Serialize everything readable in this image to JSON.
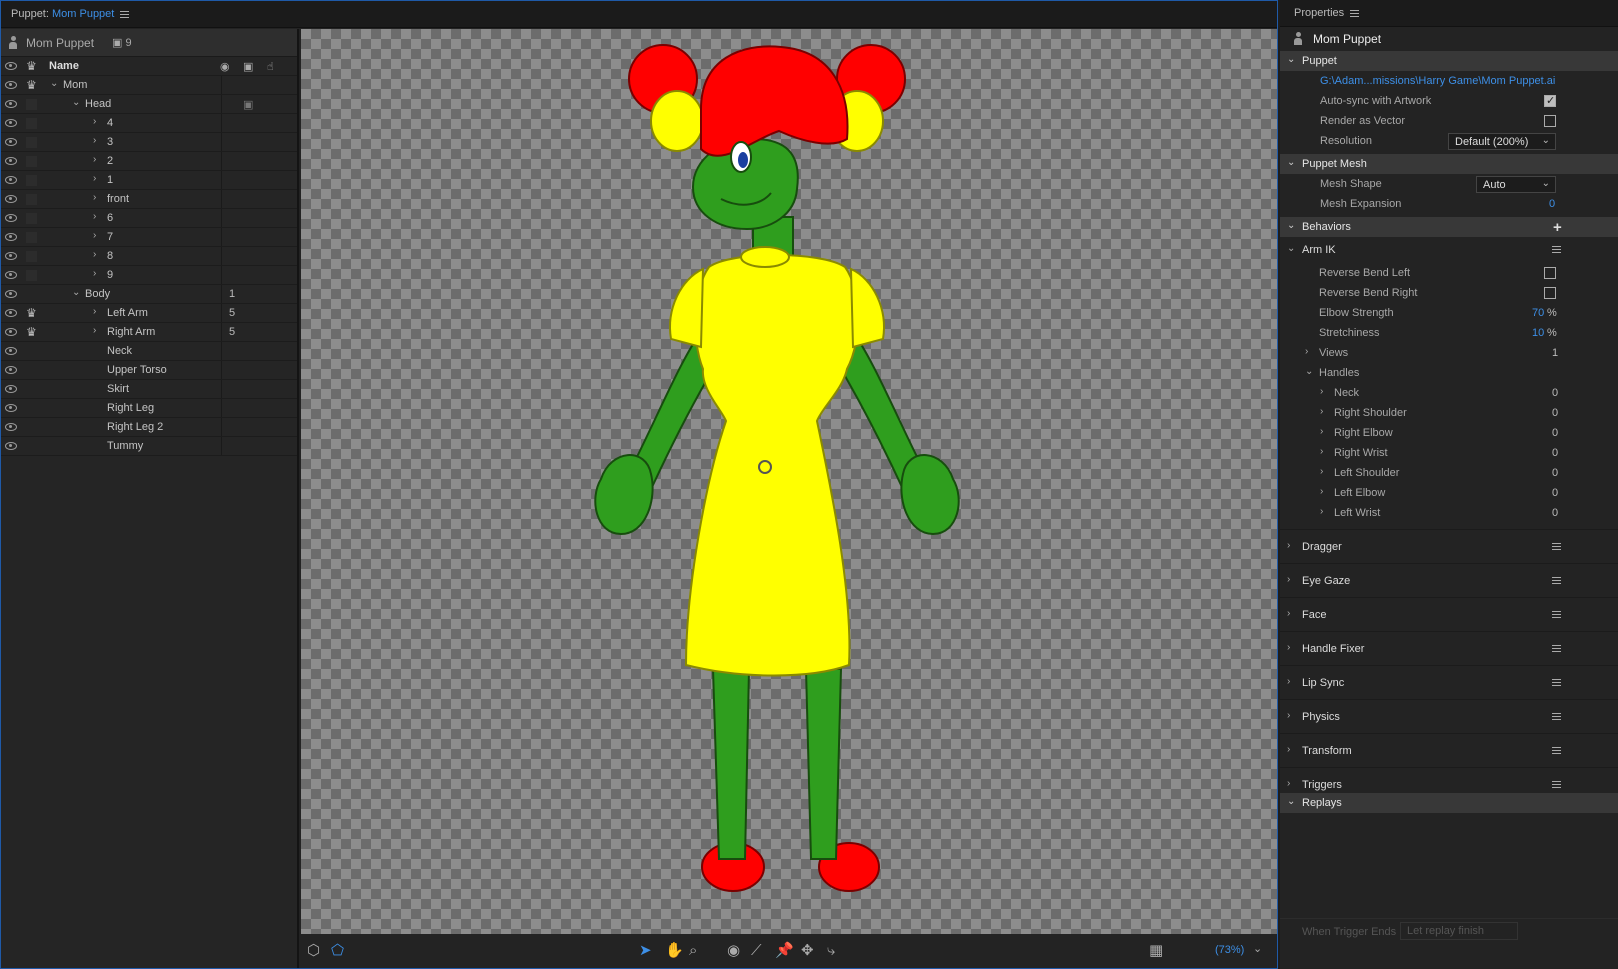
{
  "puppet_panel": {
    "title_prefix": "Puppet:",
    "title_name": "Mom Puppet",
    "puppet_name": "Mom Puppet",
    "puppet_count": "9",
    "header": {
      "name": "Name"
    },
    "layers": [
      {
        "label": "Mom",
        "num": ""
      },
      {
        "label": "Head",
        "num": ""
      },
      {
        "label": "4",
        "num": ""
      },
      {
        "label": "3",
        "num": ""
      },
      {
        "label": "2",
        "num": ""
      },
      {
        "label": "1",
        "num": ""
      },
      {
        "label": "front",
        "num": ""
      },
      {
        "label": "6",
        "num": ""
      },
      {
        "label": "7",
        "num": ""
      },
      {
        "label": "8",
        "num": ""
      },
      {
        "label": "9",
        "num": ""
      },
      {
        "label": "Body",
        "num": "1"
      },
      {
        "label": "Left Arm",
        "num": "5"
      },
      {
        "label": "Right Arm",
        "num": "5"
      },
      {
        "label": "Neck",
        "num": ""
      },
      {
        "label": "Upper Torso",
        "num": ""
      },
      {
        "label": "Skirt",
        "num": ""
      },
      {
        "label": "Right Leg",
        "num": ""
      },
      {
        "label": "Right Leg 2",
        "num": ""
      },
      {
        "label": "Tummy",
        "num": ""
      }
    ],
    "zoom": "(73%)",
    "colors": {
      "accent": "#3d8fe6",
      "hair": "#ff0000",
      "skin": "#2f9e1e",
      "dress": "#ffff00"
    }
  },
  "properties": {
    "title": "Properties",
    "puppet_name": "Mom Puppet",
    "puppet_section": {
      "label": "Puppet",
      "path": "G:\\Adam...missions\\Harry Game\\Mom Puppet.ai",
      "auto_sync_label": "Auto-sync with Artwork",
      "auto_sync": true,
      "render_vector_label": "Render as Vector",
      "render_vector": false,
      "resolution_label": "Resolution",
      "resolution_value": "Default (200%)"
    },
    "mesh_section": {
      "label": "Puppet Mesh",
      "shape_label": "Mesh Shape",
      "shape_value": "Auto",
      "expansion_label": "Mesh Expansion",
      "expansion_value": "0"
    },
    "behaviors_label": "Behaviors",
    "arm_ik": {
      "label": "Arm IK",
      "reverse_left_label": "Reverse Bend Left",
      "reverse_right_label": "Reverse Bend Right",
      "elbow_label": "Elbow Strength",
      "elbow_value": "70",
      "stretch_label": "Stretchiness",
      "stretch_value": "10",
      "percent": "%",
      "views_label": "Views",
      "views_value": "1",
      "handles_label": "Handles",
      "handles": [
        {
          "label": "Neck",
          "value": "0"
        },
        {
          "label": "Right Shoulder",
          "value": "0"
        },
        {
          "label": "Right Elbow",
          "value": "0"
        },
        {
          "label": "Right Wrist",
          "value": "0"
        },
        {
          "label": "Left Shoulder",
          "value": "0"
        },
        {
          "label": "Left Elbow",
          "value": "0"
        },
        {
          "label": "Left Wrist",
          "value": "0"
        }
      ]
    },
    "behaviors": [
      "Dragger",
      "Eye Gaze",
      "Face",
      "Handle Fixer",
      "Lip Sync",
      "Physics",
      "Transform",
      "Triggers"
    ],
    "replays_label": "Replays",
    "when_trigger_ends_label": "When Trigger Ends",
    "when_trigger_ends_value": "Let replay finish"
  }
}
